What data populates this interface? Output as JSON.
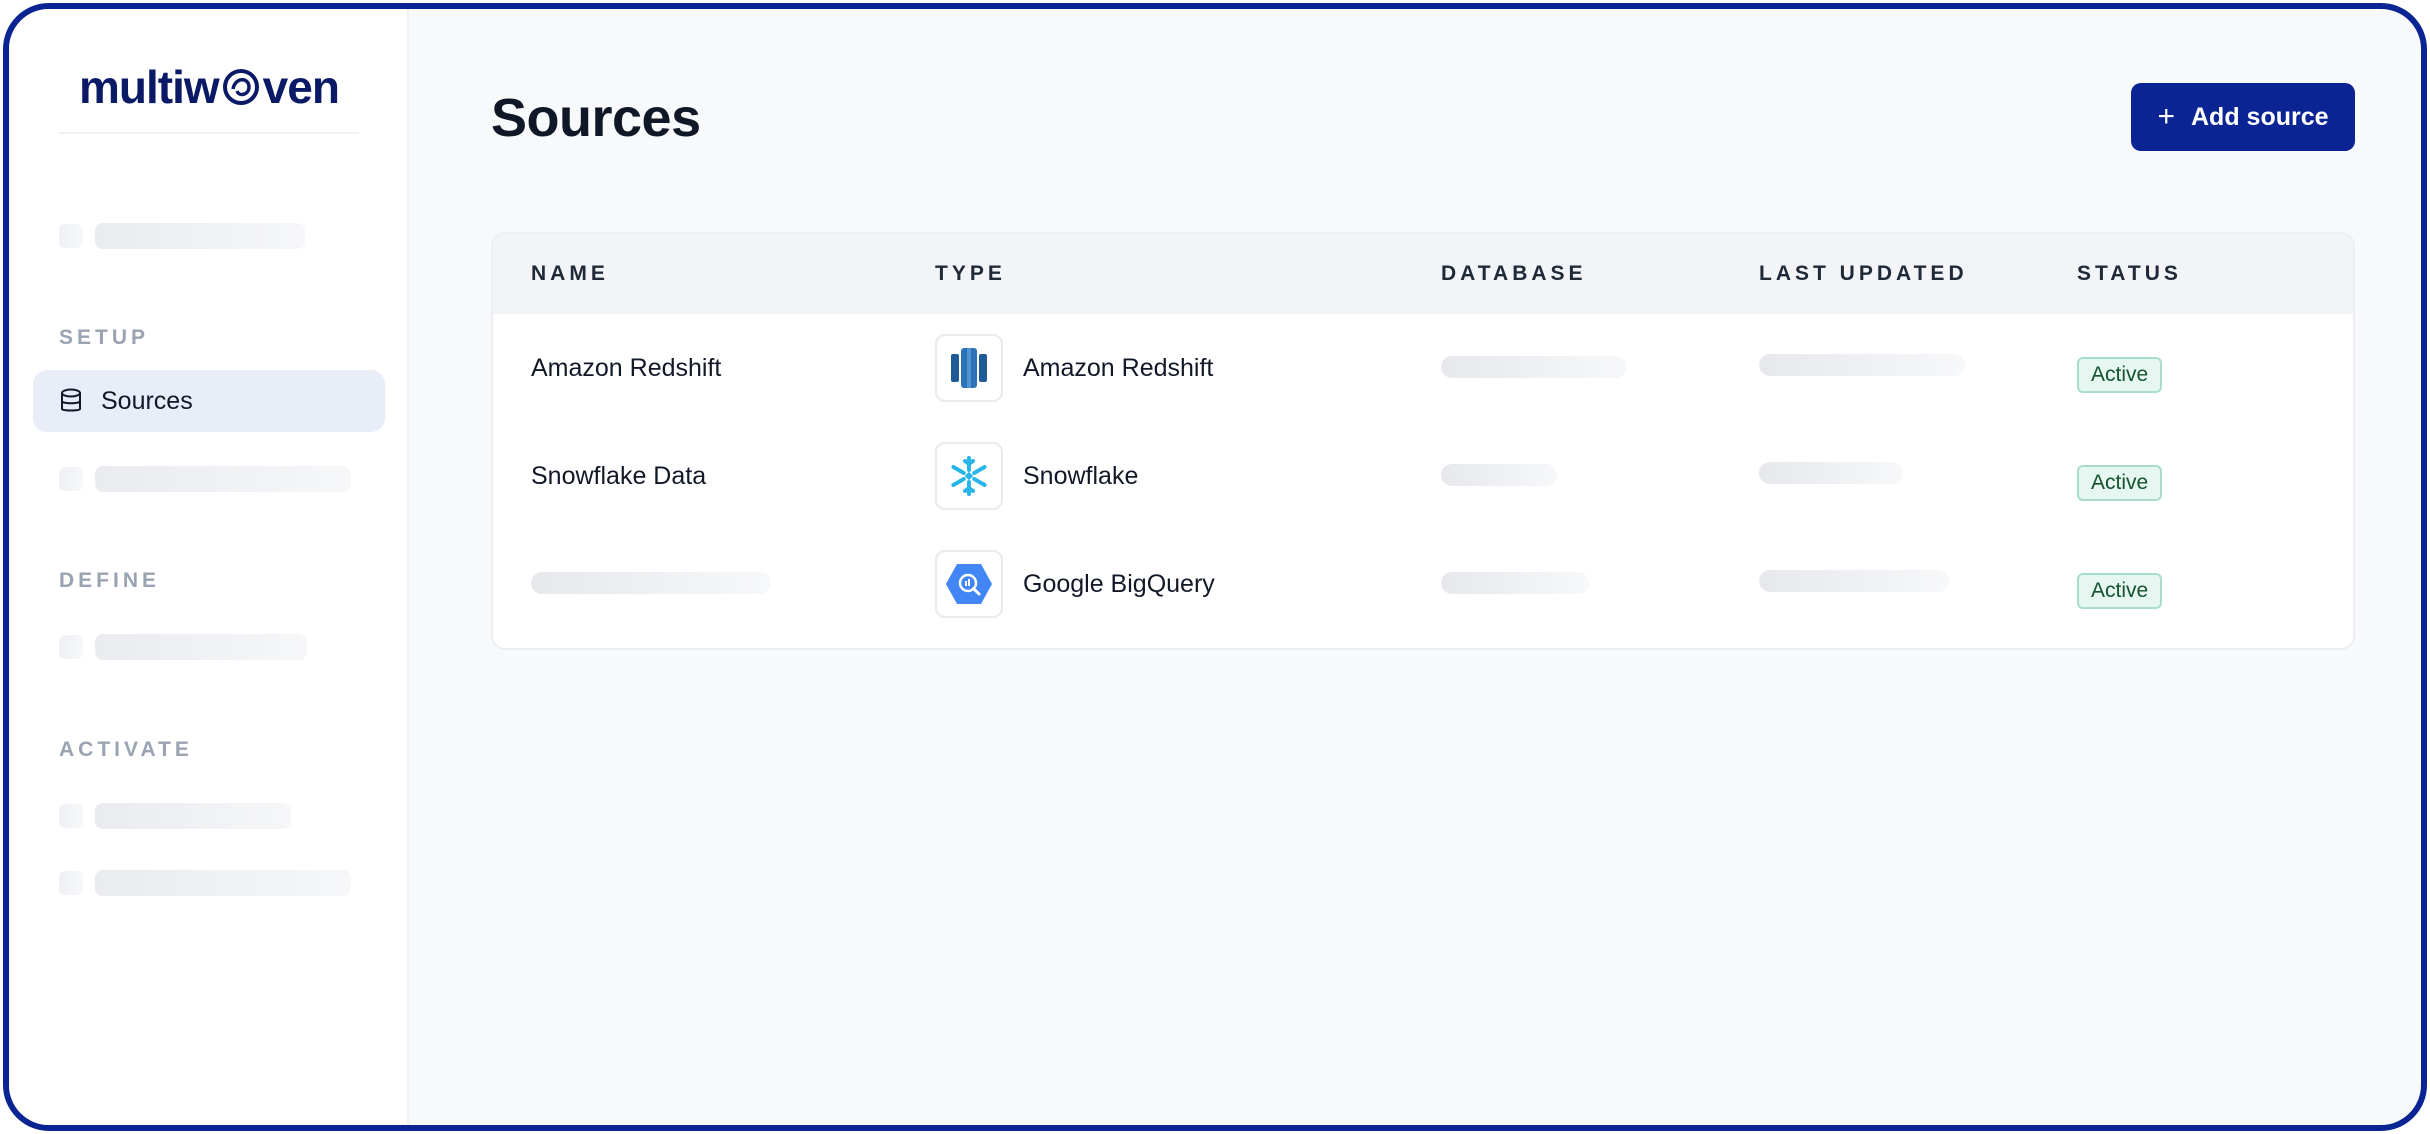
{
  "app": {
    "logo_text_left": "multiw",
    "logo_text_right": "ven"
  },
  "sidebar": {
    "sections": {
      "setup": "SETUP",
      "define": "DEFINE",
      "activate": "ACTIVATE"
    },
    "active_item": {
      "label": "Sources",
      "icon": "database-icon"
    }
  },
  "header": {
    "title": "Sources",
    "add_button": {
      "label": "Add source",
      "icon": "plus-icon"
    }
  },
  "table": {
    "columns": {
      "name": "NAME",
      "type": "TYPE",
      "database": "DATABASE",
      "last_updated": "LAST UPDATED",
      "status": "STATUS"
    },
    "rows": [
      {
        "name": "Amazon Redshift",
        "type": "Amazon Redshift",
        "type_icon": "amazon-redshift-icon",
        "status": "Active"
      },
      {
        "name": "Snowflake Data",
        "type": "Snowflake",
        "type_icon": "snowflake-icon",
        "status": "Active"
      },
      {
        "name": "",
        "type": "Google BigQuery",
        "type_icon": "google-bigquery-icon",
        "status": "Active"
      }
    ]
  },
  "colors": {
    "brand": "#0b2494",
    "active_badge_bg": "#e6f6f1",
    "active_badge_border": "#a9dcc9",
    "nav_active_bg": "#e9edf7"
  }
}
